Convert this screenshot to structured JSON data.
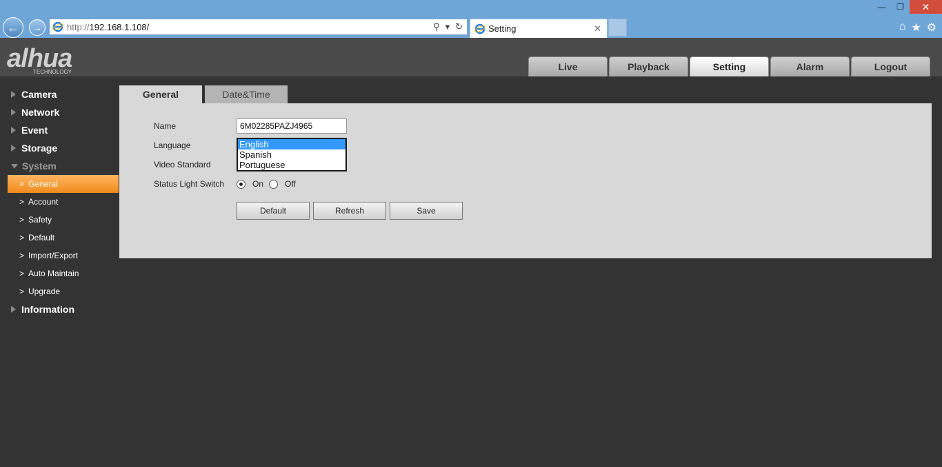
{
  "browser": {
    "url_prefix": "http://",
    "url_host": "192.168.1.108/",
    "tab_title": "Setting",
    "colors": {
      "chrome": "#6fa6d8",
      "close": "#d24c3c"
    }
  },
  "header": {
    "logo_text": "alhua",
    "logo_subtext": "TECHNOLOGY",
    "nav": [
      {
        "label": "Live"
      },
      {
        "label": "Playback"
      },
      {
        "label": "Setting"
      },
      {
        "label": "Alarm"
      },
      {
        "label": "Logout"
      }
    ]
  },
  "sidebar": {
    "top": [
      {
        "label": "Camera"
      },
      {
        "label": "Network"
      },
      {
        "label": "Event"
      },
      {
        "label": "Storage"
      },
      {
        "label": "System"
      }
    ],
    "system_items": [
      {
        "label": "General"
      },
      {
        "label": "Account"
      },
      {
        "label": "Safety"
      },
      {
        "label": "Default"
      },
      {
        "label": "Import/Export"
      },
      {
        "label": "Auto Maintain"
      },
      {
        "label": "Upgrade"
      }
    ],
    "bottom": [
      {
        "label": "Information"
      }
    ],
    "accent": "#f08b1c"
  },
  "content": {
    "tabs": [
      {
        "label": "General"
      },
      {
        "label": "Date&Time"
      }
    ],
    "form": {
      "name_label": "Name",
      "name_value": "6M02285PAZJ4965",
      "language_label": "Language",
      "language_options": [
        "English",
        "Spanish",
        "Portuguese"
      ],
      "language_selected": "English",
      "video_standard_label": "Video Standard",
      "status_light_label": "Status Light Switch",
      "on_label": "On",
      "off_label": "Off",
      "status_light_value": "On"
    },
    "buttons": {
      "default": "Default",
      "refresh": "Refresh",
      "save": "Save"
    }
  }
}
